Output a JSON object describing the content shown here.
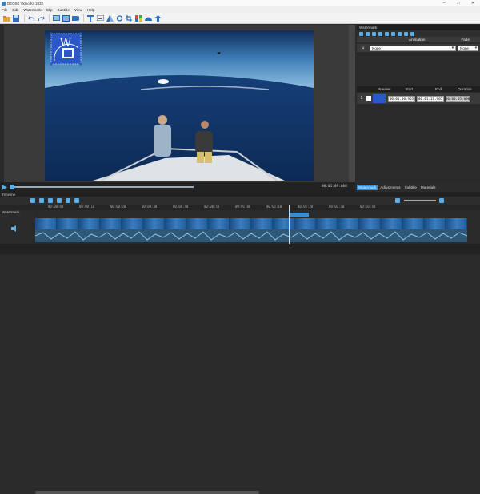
{
  "app": {
    "title": "DEOSK Video Kit 2022"
  },
  "window_controls": {
    "minimize": "–",
    "maximize": "□",
    "close": "✕"
  },
  "menu": [
    "File",
    "Edit",
    "Watermark",
    "Clip",
    "Subtitle",
    "View",
    "Help"
  ],
  "toolbar_icons": [
    "folder-open-icon",
    "save-icon",
    "undo-icon",
    "redo-icon",
    "video-import-icon",
    "image-import-icon",
    "camera-import-icon",
    "text-icon",
    "subtitle-icon",
    "flip-icon",
    "rotate-icon",
    "crop-icon",
    "color-icon",
    "speed-icon",
    "export-icon"
  ],
  "right_panel": {
    "header": "Watermark",
    "col_animation": "Animation",
    "col_fade": "Fade",
    "row_index": "1",
    "animation_value": "None",
    "fade_value": "None",
    "lower_cols": {
      "preview": "Preview",
      "start": "Start",
      "end": "End",
      "duration": "Duration"
    },
    "clip": {
      "index": "1",
      "start": "00:01:06:965",
      "end": "00:01:11:965",
      "duration": "00:00:05:000"
    }
  },
  "player": {
    "timecode": "00:01:09:608"
  },
  "tabs": [
    "Watermark",
    "Adjustments",
    "Subtitle",
    "Materials"
  ],
  "active_tab": "Watermark",
  "timeline": {
    "header": "Timeline",
    "track_label": "Watermark",
    "ruler": [
      "00:00:00",
      "00:00:10",
      "00:00:20",
      "00:00:30",
      "00:00:40",
      "00:00:50",
      "00:01:00",
      "00:01:10",
      "00:01:20",
      "00:01:30",
      "00:01:40"
    ]
  },
  "colors": {
    "accent": "#2f8fd8",
    "watermark_blue": "#2a58c6"
  }
}
